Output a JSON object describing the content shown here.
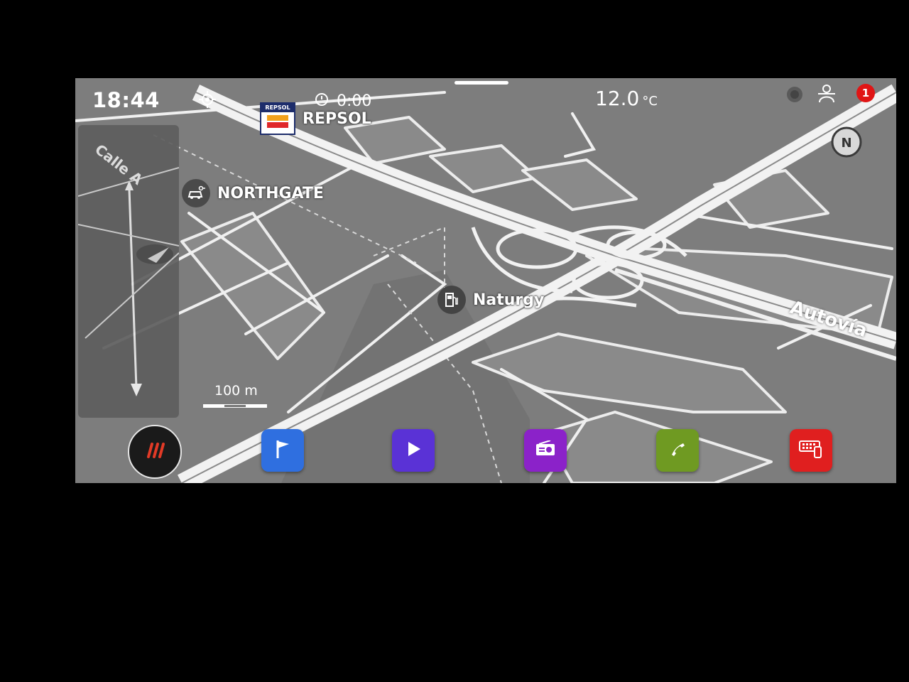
{
  "status_bar": {
    "time": "18:44",
    "trip_time": "0:00",
    "temperature": "12.0",
    "temperature_unit": "°C",
    "notification_count": "1"
  },
  "map": {
    "pois": [
      {
        "id": "repsol",
        "label": "REPSOL",
        "logo_text": "REPSOL",
        "icon": "repsol-logo-icon"
      },
      {
        "id": "northgate",
        "label": "NORTHGATE",
        "icon": "car-rental-icon"
      },
      {
        "id": "naturgy",
        "label": "Naturgy",
        "icon": "fuel-station-icon"
      }
    ],
    "road_labels": {
      "calle_a": "Calle A",
      "autovia": "Autovía"
    },
    "scale": "100 m",
    "compass": "N"
  },
  "dock": {
    "items": [
      {
        "name": "home-menu",
        "icon": "menu-stripes-icon",
        "color": "#e23a26"
      },
      {
        "name": "navigation",
        "icon": "flag-icon",
        "color": "#2f6fe0"
      },
      {
        "name": "media",
        "icon": "play-icon",
        "color": "#5a32d6"
      },
      {
        "name": "radio",
        "icon": "radio-icon",
        "color": "#8b22c9"
      },
      {
        "name": "phone",
        "icon": "phone-icon",
        "color": "#6f9a22"
      },
      {
        "name": "car-settings",
        "icon": "keypad-phone-icon",
        "color": "#e01f1f"
      }
    ]
  },
  "colors": {
    "map_background": "#7d7d7d",
    "road": "#f2f2f2",
    "block": "#8c8c8c"
  }
}
